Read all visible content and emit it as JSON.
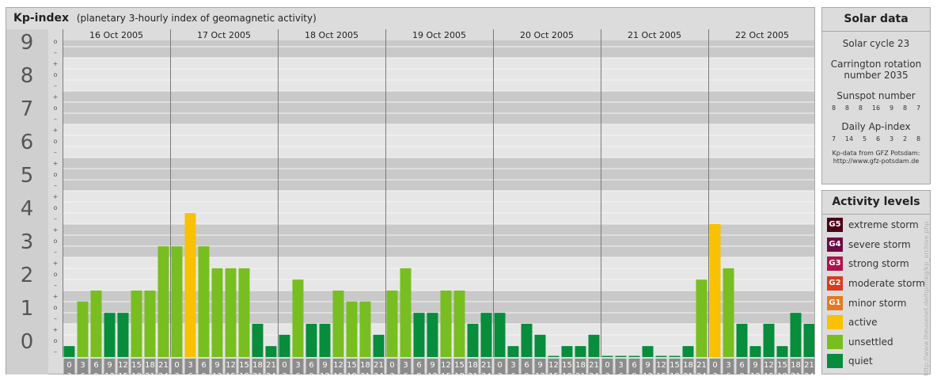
{
  "header": {
    "title": "Kp-index",
    "subtitle": "(planetary 3-hourly index of geomagnetic activity)"
  },
  "chart_data": {
    "type": "bar",
    "y_levels": [
      "0",
      "1",
      "2",
      "3",
      "4",
      "5",
      "6",
      "7",
      "8",
      "9"
    ],
    "sub_marks": [
      "+",
      "o",
      "–"
    ],
    "ylim": [
      0,
      9.33
    ],
    "days": [
      "16 Oct 2005",
      "17 Oct 2005",
      "18 Oct 2005",
      "19 Oct 2005",
      "20 Oct 2005",
      "21 Oct 2005",
      "22 Oct 2005"
    ],
    "hour_top": [
      "0",
      "3",
      "6",
      "9",
      "12",
      "15",
      "18",
      "21"
    ],
    "hour_bottom": [
      "3",
      "6",
      "9",
      "12",
      "15",
      "18",
      "21",
      "24"
    ],
    "values": [
      [
        0.33,
        1.67,
        2.0,
        1.33,
        1.33,
        2.0,
        2.0,
        3.33
      ],
      [
        3.33,
        4.33,
        3.33,
        2.67,
        2.67,
        2.67,
        1.0,
        0.33
      ],
      [
        0.67,
        2.33,
        1.0,
        1.0,
        2.0,
        1.67,
        1.67,
        0.67
      ],
      [
        2.0,
        2.67,
        1.33,
        1.33,
        2.0,
        2.0,
        1.0,
        1.33
      ],
      [
        1.33,
        0.33,
        1.0,
        0.67,
        0.0,
        0.33,
        0.33,
        0.67
      ],
      [
        0.0,
        0.0,
        0.0,
        0.33,
        0.0,
        0.0,
        0.33,
        2.33
      ],
      [
        4.0,
        2.67,
        1.0,
        0.33,
        1.0,
        0.33,
        1.33,
        1.0
      ]
    ],
    "colors": {
      "quiet": "#078d3c",
      "unsettled": "#78be20",
      "active": "#f9c100"
    },
    "grid": true
  },
  "solar": {
    "title": "Solar data",
    "cycle": "Solar cycle 23",
    "carrington_line1": "Carrington rotation",
    "carrington_line2": "number 2035",
    "sunspot_label": "Sunspot number",
    "sunspot_values": [
      "8",
      "8",
      "8",
      "16",
      "9",
      "8",
      "7"
    ],
    "ap_label": "Daily Ap-index",
    "ap_values": [
      "7",
      "14",
      "5",
      "6",
      "3",
      "2",
      "8"
    ],
    "credit_line1": "Kp-data from GFZ Potsdam:",
    "credit_line2": "http://www.gfz-potsdam.de"
  },
  "activity": {
    "title": "Activity levels",
    "items": [
      {
        "badge": "G5",
        "label": "extreme storm",
        "color": "#4b0018"
      },
      {
        "badge": "G4",
        "label": "severe storm",
        "color": "#6e0b46"
      },
      {
        "badge": "G3",
        "label": "strong storm",
        "color": "#b0124e"
      },
      {
        "badge": "G2",
        "label": "moderate storm",
        "color": "#dc3a1a"
      },
      {
        "badge": "G1",
        "label": "minor storm",
        "color": "#e87820"
      },
      {
        "badge": "",
        "label": "active",
        "color": "#f9c100"
      },
      {
        "badge": "",
        "label": "unsettled",
        "color": "#78be20"
      },
      {
        "badge": "",
        "label": "quiet",
        "color": "#078d3c"
      }
    ]
  },
  "side_note": "http://www.theusenet.de/hp/mkg/kp_archive.php"
}
